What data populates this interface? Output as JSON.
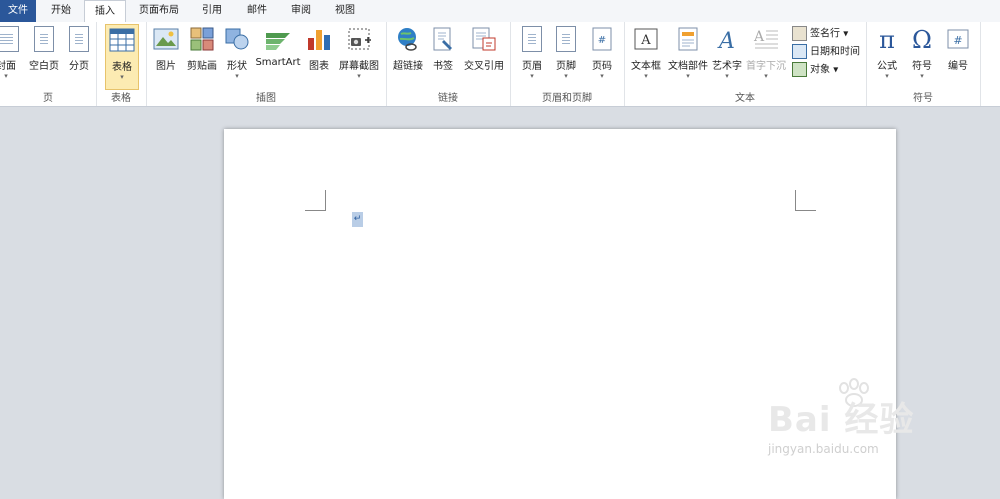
{
  "tabs": [
    "文件",
    "开始",
    "插入",
    "页面布局",
    "引用",
    "邮件",
    "审阅",
    "视图"
  ],
  "active_tab": "插入",
  "groups": {
    "page": {
      "label": "页",
      "buttons": [
        "封面",
        "空白页",
        "分页"
      ]
    },
    "table": {
      "label": "表格",
      "buttons": [
        "表格"
      ]
    },
    "illustrations": {
      "label": "插图",
      "buttons": [
        "图片",
        "剪贴画",
        "形状",
        "SmartArt",
        "图表",
        "屏幕截图"
      ]
    },
    "links": {
      "label": "链接",
      "buttons": [
        "超链接",
        "书签",
        "交叉引用"
      ]
    },
    "header_footer": {
      "label": "页眉和页脚",
      "buttons": [
        "页眉",
        "页脚",
        "页码"
      ]
    },
    "text": {
      "label": "文本",
      "buttons": [
        "文本框",
        "文档部件",
        "艺术字",
        "首字下沉"
      ],
      "small": [
        "签名行",
        "日期和时间",
        "对象"
      ]
    },
    "symbols": {
      "label": "符号",
      "buttons": [
        "公式",
        "符号",
        "编号"
      ]
    }
  },
  "document": {
    "paragraph_mark": "↵"
  },
  "watermark": {
    "brand": "Bai 经验",
    "site": "jingyan.baidu.com"
  },
  "colors": {
    "file_tab": "#2b579a",
    "selected_button": "#fcebb2",
    "workspace": "#d9dde3"
  }
}
